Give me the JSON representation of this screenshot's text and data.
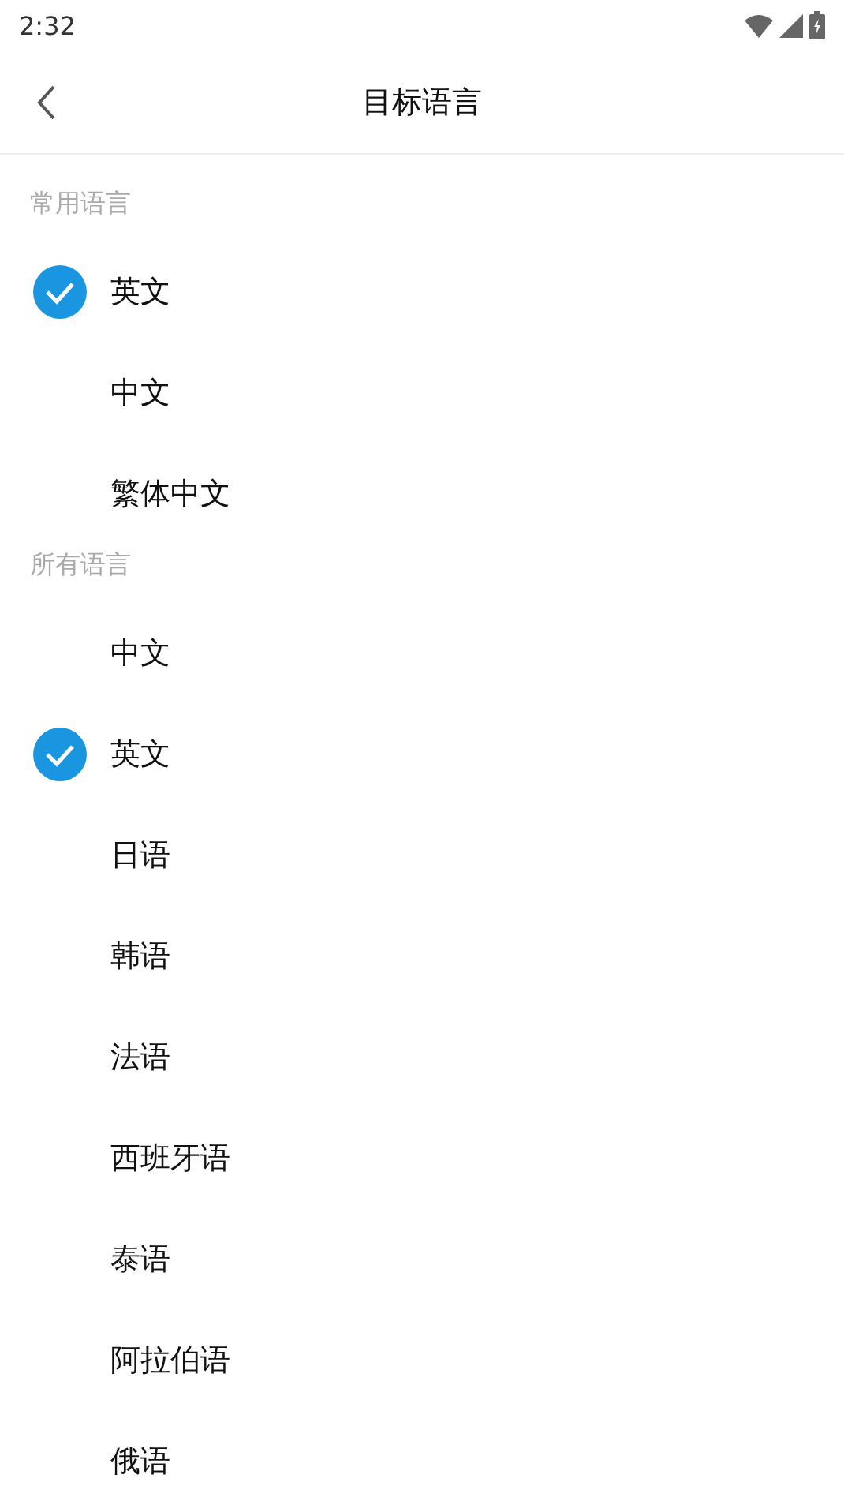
{
  "status_bar": {
    "time": "2:32"
  },
  "header": {
    "title": "目标语言"
  },
  "sections": [
    {
      "label": "常用语言",
      "items": [
        {
          "name": "英文",
          "selected": true
        },
        {
          "name": "中文",
          "selected": false
        },
        {
          "name": "繁体中文",
          "selected": false
        }
      ]
    },
    {
      "label": "所有语言",
      "items": [
        {
          "name": "中文",
          "selected": false
        },
        {
          "name": "英文",
          "selected": true
        },
        {
          "name": "日语",
          "selected": false
        },
        {
          "name": "韩语",
          "selected": false
        },
        {
          "name": "法语",
          "selected": false
        },
        {
          "name": "西班牙语",
          "selected": false
        },
        {
          "name": "泰语",
          "selected": false
        },
        {
          "name": "阿拉伯语",
          "selected": false
        },
        {
          "name": "俄语",
          "selected": false
        }
      ]
    }
  ]
}
